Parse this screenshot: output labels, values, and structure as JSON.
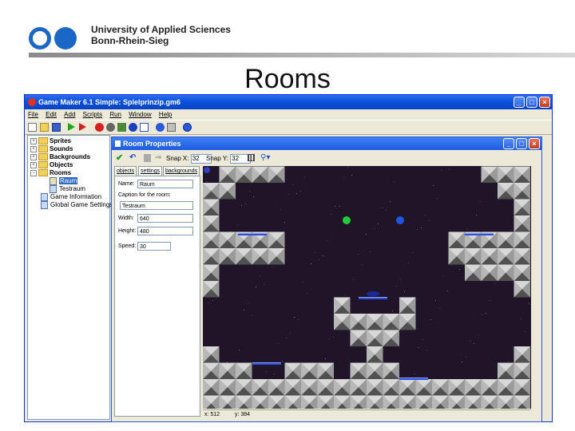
{
  "header": {
    "institution_line1": "University of Applied Sciences",
    "institution_line2": "Bonn-Rhein-Sieg",
    "slide_title": "Rooms"
  },
  "window": {
    "title": "Game Maker 6.1 Simple: Spielprinzip.gm6",
    "menu": [
      "File",
      "Edit",
      "Add",
      "Scripts",
      "Run",
      "Window",
      "Help"
    ],
    "toolbar_icons": [
      "new-icon",
      "open-icon",
      "save-icon",
      "run-icon",
      "run-debug-icon",
      "sprite-icon",
      "sound-icon",
      "background-icon",
      "object-icon",
      "room-icon",
      "info-icon",
      "settings-icon",
      "help-icon"
    ]
  },
  "tree": {
    "items": [
      {
        "label": "Sprites",
        "kind": "folder"
      },
      {
        "label": "Sounds",
        "kind": "folder"
      },
      {
        "label": "Backgrounds",
        "kind": "folder"
      },
      {
        "label": "Objects",
        "kind": "folder"
      },
      {
        "label": "Rooms",
        "kind": "folder"
      },
      {
        "label": "Raum",
        "kind": "resource"
      },
      {
        "label": "Testraum",
        "kind": "resource"
      },
      {
        "label": "Game Information",
        "kind": "resource"
      },
      {
        "label": "Global Game Settings",
        "kind": "resource"
      }
    ]
  },
  "room": {
    "title": "Room Properties",
    "snap_x_label": "Snap X:",
    "snap_x": "32",
    "snap_y_label": "Snap Y:",
    "snap_y": "32",
    "tabs": [
      "objects",
      "settings",
      "backgrounds"
    ],
    "active_tab": "settings",
    "name_label": "Name:",
    "name": "Raum",
    "caption_label": "Caption for the room:",
    "caption": "Testraum",
    "width_label": "Width:",
    "width": "640",
    "height_label": "Height:",
    "height": "480",
    "speed_label": "Speed:",
    "speed": "30",
    "status_x": "x: 512",
    "status_y": "y: 384"
  },
  "colors": {
    "title_blue": "#0a4fd8",
    "room_bg": "#201528",
    "platform": "#2f4de0",
    "ball_green": "#22cc33",
    "ball_blue": "#1f55e6"
  }
}
